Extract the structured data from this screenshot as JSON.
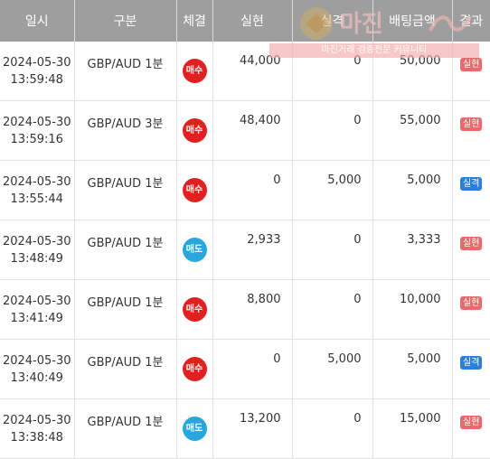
{
  "table": {
    "headers": {
      "date": "일시",
      "type": "구분",
      "direction": "체결",
      "realized": "실현",
      "loss": "실격",
      "bet": "배팅금액",
      "result": "결과"
    },
    "rows": [
      {
        "date": "2024-05-30",
        "time": "13:59:48",
        "type": "GBP/AUD 1분",
        "direction": "매수",
        "realized": "44,000",
        "loss": "0",
        "bet": "50,000",
        "result": "실현"
      },
      {
        "date": "2024-05-30",
        "time": "13:59:16",
        "type": "GBP/AUD 3분",
        "direction": "매수",
        "realized": "48,400",
        "loss": "0",
        "bet": "55,000",
        "result": "실현"
      },
      {
        "date": "2024-05-30",
        "time": "13:55:44",
        "type": "GBP/AUD 1분",
        "direction": "매수",
        "realized": "0",
        "loss": "5,000",
        "bet": "5,000",
        "result": "실격"
      },
      {
        "date": "2024-05-30",
        "time": "13:48:49",
        "type": "GBP/AUD 1분",
        "direction": "매도",
        "realized": "2,933",
        "loss": "0",
        "bet": "3,333",
        "result": "실현"
      },
      {
        "date": "2024-05-30",
        "time": "13:41:49",
        "type": "GBP/AUD 1분",
        "direction": "매수",
        "realized": "8,800",
        "loss": "0",
        "bet": "10,000",
        "result": "실현"
      },
      {
        "date": "2024-05-30",
        "time": "13:40:49",
        "type": "GBP/AUD 1분",
        "direction": "매수",
        "realized": "0",
        "loss": "5,000",
        "bet": "5,000",
        "result": "실격"
      },
      {
        "date": "2024-05-30",
        "time": "13:38:48",
        "type": "GBP/AUD 1분",
        "direction": "매도",
        "realized": "13,200",
        "loss": "0",
        "bet": "15,000",
        "result": "실현"
      }
    ]
  },
  "watermark": {
    "logo": "마진",
    "tagline": "마진거래 검증전문 커뮤니티"
  },
  "colors": {
    "header_bg": "#9e9e9e",
    "buy": "#e12020",
    "sell": "#27a7db",
    "badge_realized": "#e86a6a",
    "badge_loss": "#2c7fd8"
  }
}
